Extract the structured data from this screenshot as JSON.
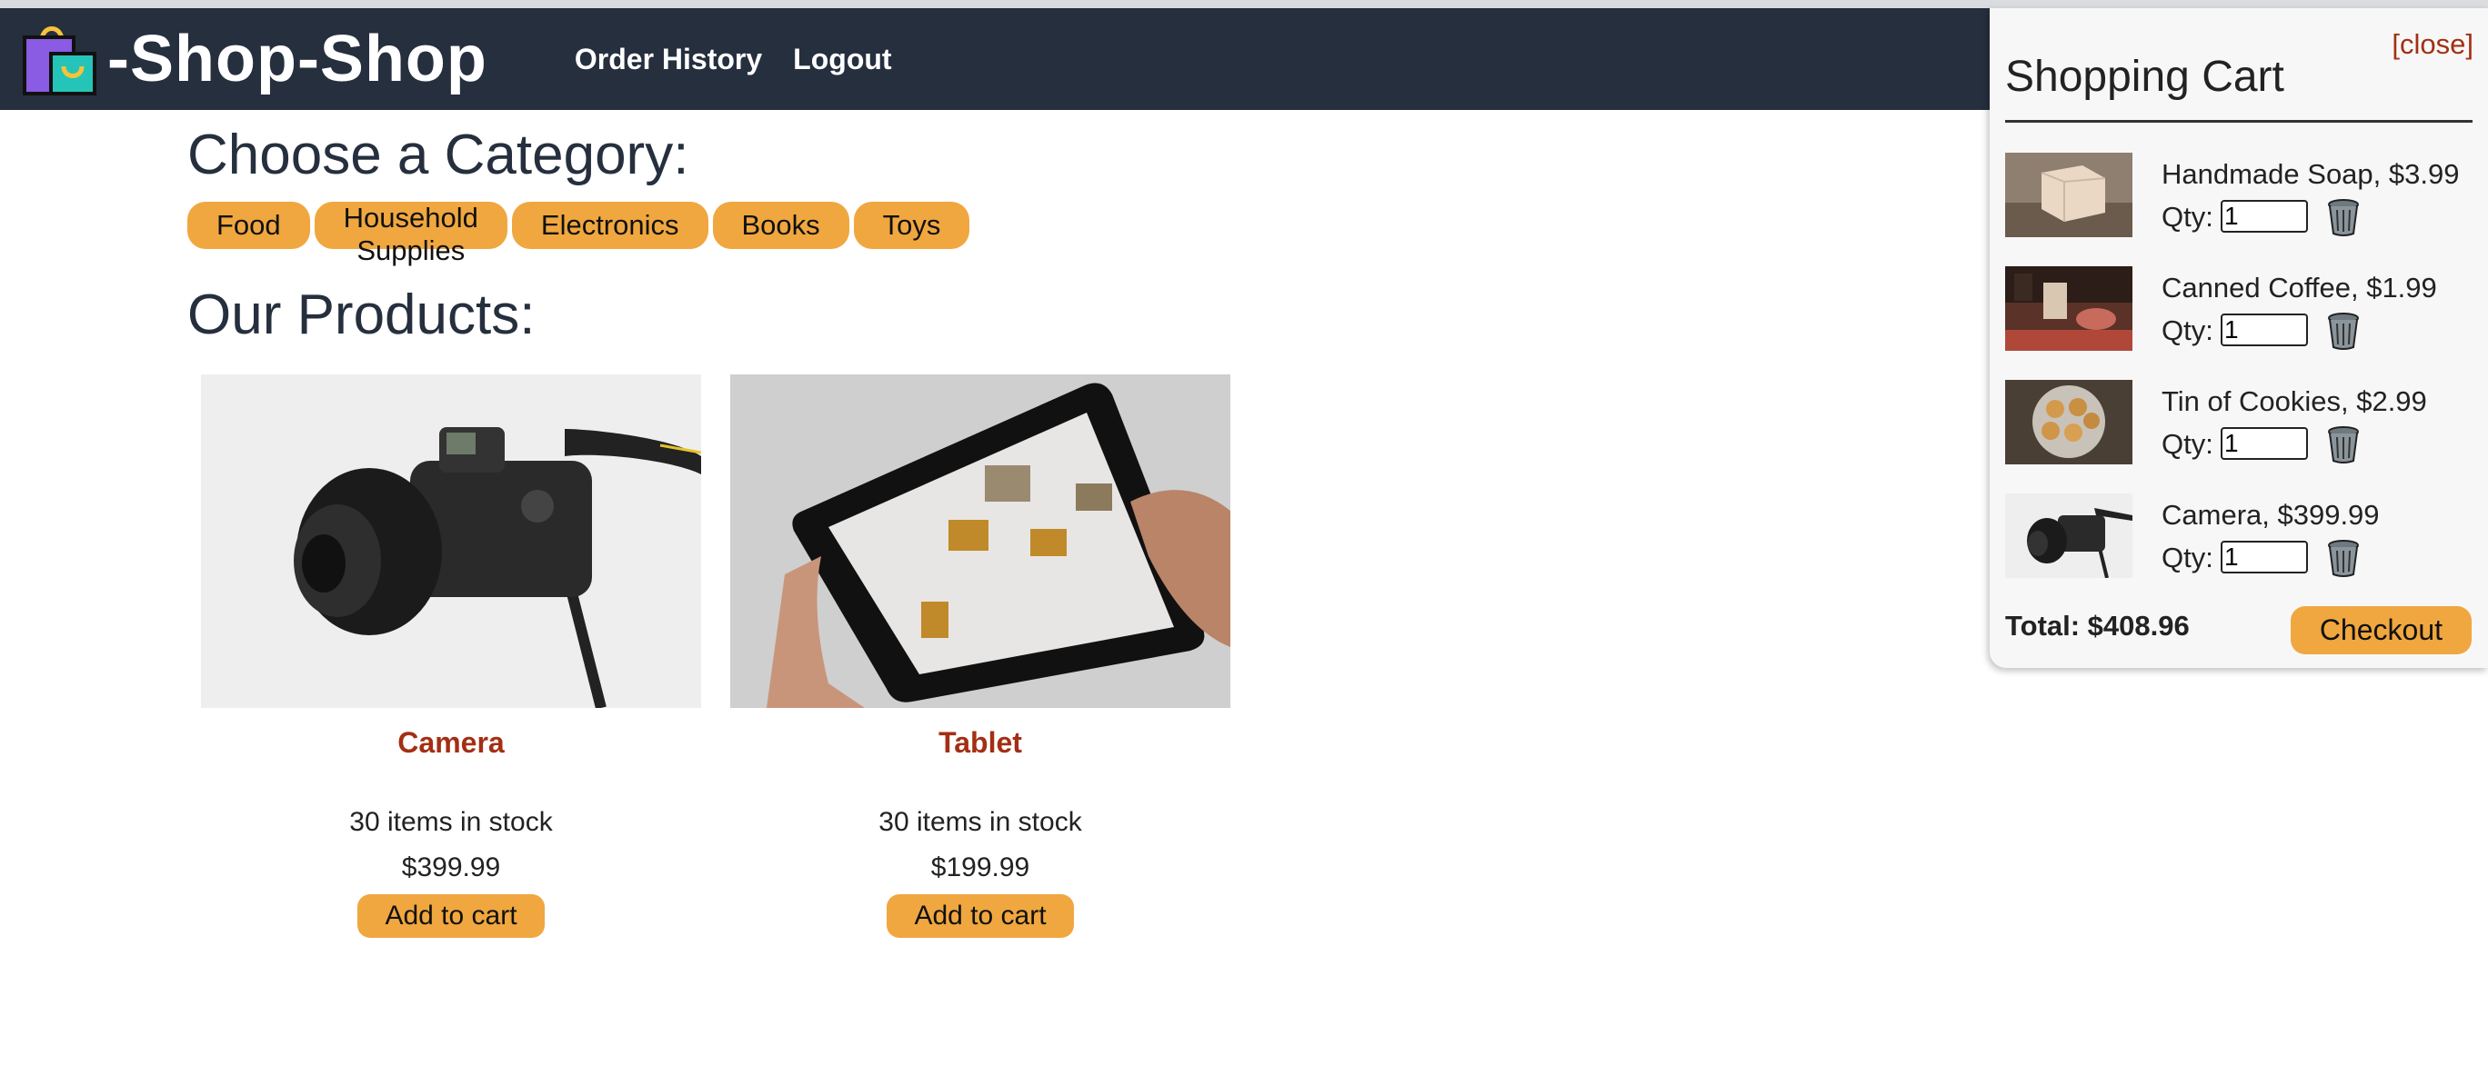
{
  "header": {
    "brand": "-Shop-Shop",
    "nav": [
      "Order History",
      "Logout"
    ]
  },
  "categories": {
    "title": "Choose a Category:",
    "items": [
      "Food",
      "Household Supplies",
      "Electronics",
      "Books",
      "Toys"
    ]
  },
  "products": {
    "title": "Our Products:",
    "items": [
      {
        "name": "Camera",
        "stock": "30 items in stock",
        "price": "$399.99",
        "button": "Add to cart"
      },
      {
        "name": "Tablet",
        "stock": "30 items in stock",
        "price": "$199.99",
        "button": "Add to cart"
      }
    ]
  },
  "cart": {
    "close": "[close]",
    "title": "Shopping Cart",
    "qty_label": "Qty:",
    "items": [
      {
        "label": "Handmade Soap, $3.99",
        "qty": "1"
      },
      {
        "label": "Canned Coffee, $1.99",
        "qty": "1"
      },
      {
        "label": "Tin of Cookies, $2.99",
        "qty": "1"
      },
      {
        "label": "Camera, $399.99",
        "qty": "1"
      }
    ],
    "total": "Total: $408.96",
    "checkout": "Checkout"
  },
  "colors": {
    "header_bg": "#262f3e",
    "accent": "#f0a73f",
    "product_name": "#a32f14",
    "close_link": "#a32f14"
  },
  "icons": [
    "shopping-bag-icon",
    "trash-icon"
  ]
}
